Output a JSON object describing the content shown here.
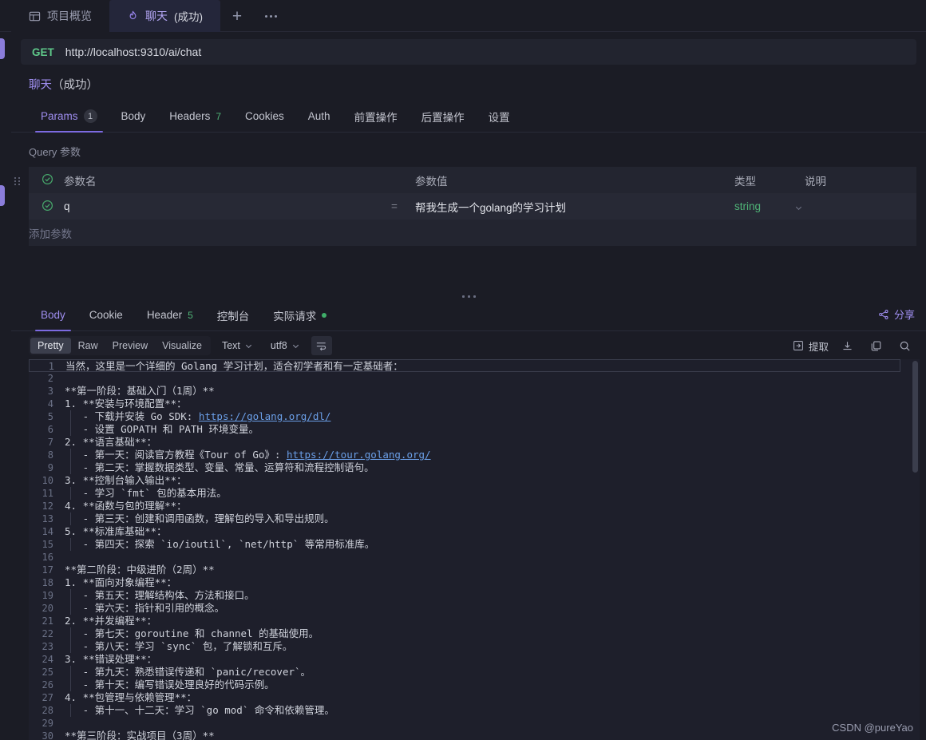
{
  "window": {
    "tabs": [
      {
        "label": "项目概览",
        "icon": "layout-icon",
        "active": false
      },
      {
        "label": "聊天",
        "suffix": "(成功)",
        "icon": "flame-icon",
        "active": true
      }
    ],
    "new_tab_label": "+",
    "more_label": "···"
  },
  "request": {
    "method": "GET",
    "url": "http://localhost:9310/ai/chat",
    "title_name": "聊天",
    "title_status": "（成功）",
    "tabs": [
      {
        "label": "Params",
        "badge": "1",
        "badge_type": "pill",
        "active": true
      },
      {
        "label": "Body",
        "badge": "",
        "badge_type": "none",
        "active": false
      },
      {
        "label": "Headers",
        "badge": "7",
        "badge_type": "green",
        "active": false
      },
      {
        "label": "Cookies",
        "badge": "",
        "badge_type": "none",
        "active": false
      },
      {
        "label": "Auth",
        "badge": "",
        "badge_type": "none",
        "active": false
      },
      {
        "label": "前置操作",
        "badge": "",
        "badge_type": "none",
        "active": false
      },
      {
        "label": "后置操作",
        "badge": "",
        "badge_type": "none",
        "active": false
      },
      {
        "label": "设置",
        "badge": "",
        "badge_type": "none",
        "active": false
      }
    ],
    "query_section_label": "Query 参数",
    "table": {
      "headers": {
        "name": "参数名",
        "value": "参数值",
        "type": "类型",
        "desc": "说明"
      },
      "rows": [
        {
          "checked": true,
          "name": "q",
          "equals": "=",
          "value": "帮我生成一个golang的学习计划",
          "type": "string",
          "desc": ""
        }
      ],
      "add_row_label": "添加参数"
    }
  },
  "response": {
    "tabs": [
      {
        "label": "Body",
        "badge": "",
        "badge_type": "none",
        "dot": false,
        "active": true
      },
      {
        "label": "Cookie",
        "badge": "",
        "badge_type": "none",
        "dot": false,
        "active": false
      },
      {
        "label": "Header",
        "badge": "5",
        "badge_type": "green",
        "dot": false,
        "active": false
      },
      {
        "label": "控制台",
        "badge": "",
        "badge_type": "none",
        "dot": false,
        "active": false
      },
      {
        "label": "实际请求",
        "badge": "",
        "badge_type": "none",
        "dot": true,
        "active": false
      }
    ],
    "share_label": "分享",
    "toolbar": {
      "view_modes": [
        "Pretty",
        "Raw",
        "Preview",
        "Visualize"
      ],
      "active_view_mode": "Pretty",
      "format_select": "Text",
      "encoding_select": "utf8",
      "wrap_icon": "word-wrap-icon",
      "extract_label": "提取",
      "download_icon": "download-icon",
      "copy_icon": "copy-icon",
      "search_icon": "search-icon"
    },
    "code_lines": [
      {
        "n": "1",
        "indent": 0,
        "tokens": [
          {
            "t": "text",
            "v": "当然，这里是一个详细的 "
          },
          {
            "t": "code",
            "v": "Golang"
          },
          {
            "t": "text",
            "v": " 学习计划，适合初学者和有一定基础者："
          }
        ]
      },
      {
        "n": "2",
        "indent": 0,
        "tokens": []
      },
      {
        "n": "3",
        "indent": 0,
        "tokens": [
          {
            "t": "text",
            "v": "**第一阶段：基础入门（1周）**"
          }
        ]
      },
      {
        "n": "4",
        "indent": 0,
        "tokens": [
          {
            "t": "text",
            "v": "1. **安装与环境配置**："
          }
        ]
      },
      {
        "n": "5",
        "indent": 1,
        "tokens": [
          {
            "t": "text",
            "v": "   - 下载并安装 Go SDK: "
          },
          {
            "t": "link",
            "v": "https://golang.org/dl/"
          }
        ]
      },
      {
        "n": "6",
        "indent": 1,
        "tokens": [
          {
            "t": "text",
            "v": "   - 设置 GOPATH 和 PATH 环境变量。"
          }
        ]
      },
      {
        "n": "7",
        "indent": 0,
        "tokens": [
          {
            "t": "text",
            "v": "2. **语言基础**："
          }
        ]
      },
      {
        "n": "8",
        "indent": 1,
        "tokens": [
          {
            "t": "text",
            "v": "   - 第一天：阅读官方教程《Tour of Go》: "
          },
          {
            "t": "link",
            "v": "https://tour.golang.org/"
          }
        ]
      },
      {
        "n": "9",
        "indent": 1,
        "tokens": [
          {
            "t": "text",
            "v": "   - 第二天：掌握数据类型、变量、常量、运算符和流程控制语句。"
          }
        ]
      },
      {
        "n": "10",
        "indent": 0,
        "tokens": [
          {
            "t": "text",
            "v": "3. **控制台输入输出**："
          }
        ]
      },
      {
        "n": "11",
        "indent": 1,
        "tokens": [
          {
            "t": "text",
            "v": "   - 学习 `fmt` 包的基本用法。"
          }
        ]
      },
      {
        "n": "12",
        "indent": 0,
        "tokens": [
          {
            "t": "text",
            "v": "4. **函数与包的理解**："
          }
        ]
      },
      {
        "n": "13",
        "indent": 1,
        "tokens": [
          {
            "t": "text",
            "v": "   - 第三天：创建和调用函数，理解包的导入和导出规则。"
          }
        ]
      },
      {
        "n": "14",
        "indent": 0,
        "tokens": [
          {
            "t": "text",
            "v": "5. **标准库基础**："
          }
        ]
      },
      {
        "n": "15",
        "indent": 1,
        "tokens": [
          {
            "t": "text",
            "v": "   - 第四天：探索 `io/ioutil`, `net/http` 等常用标准库。"
          }
        ]
      },
      {
        "n": "16",
        "indent": 0,
        "tokens": []
      },
      {
        "n": "17",
        "indent": 0,
        "tokens": [
          {
            "t": "text",
            "v": "**第二阶段：中级进阶（2周）**"
          }
        ]
      },
      {
        "n": "18",
        "indent": 0,
        "tokens": [
          {
            "t": "text",
            "v": "1. **面向对象编程**："
          }
        ]
      },
      {
        "n": "19",
        "indent": 1,
        "tokens": [
          {
            "t": "text",
            "v": "   - 第五天：理解结构体、方法和接口。"
          }
        ]
      },
      {
        "n": "20",
        "indent": 1,
        "tokens": [
          {
            "t": "text",
            "v": "   - 第六天：指针和引用的概念。"
          }
        ]
      },
      {
        "n": "21",
        "indent": 0,
        "tokens": [
          {
            "t": "text",
            "v": "2. **并发编程**："
          }
        ]
      },
      {
        "n": "22",
        "indent": 1,
        "tokens": [
          {
            "t": "text",
            "v": "   - 第七天：goroutine 和 channel 的基础使用。"
          }
        ]
      },
      {
        "n": "23",
        "indent": 1,
        "tokens": [
          {
            "t": "text",
            "v": "   - 第八天：学习 `sync` 包，了解锁和互斥。"
          }
        ]
      },
      {
        "n": "24",
        "indent": 0,
        "tokens": [
          {
            "t": "text",
            "v": "3. **错误处理**："
          }
        ]
      },
      {
        "n": "25",
        "indent": 1,
        "tokens": [
          {
            "t": "text",
            "v": "   - 第九天：熟悉错误传递和 `panic/recover`。"
          }
        ]
      },
      {
        "n": "26",
        "indent": 1,
        "tokens": [
          {
            "t": "text",
            "v": "   - 第十天：编写错误处理良好的代码示例。"
          }
        ]
      },
      {
        "n": "27",
        "indent": 0,
        "tokens": [
          {
            "t": "text",
            "v": "4. **包管理与依赖管理**："
          }
        ]
      },
      {
        "n": "28",
        "indent": 1,
        "tokens": [
          {
            "t": "text",
            "v": "   - 第十一、十二天：学习 `go mod` 命令和依赖管理。"
          }
        ]
      },
      {
        "n": "29",
        "indent": 0,
        "tokens": []
      },
      {
        "n": "30",
        "indent": 0,
        "tokens": [
          {
            "t": "text",
            "v": "**第三阶段：实战项目（3周）**"
          }
        ]
      }
    ]
  },
  "watermark": "CSDN @pureYao"
}
